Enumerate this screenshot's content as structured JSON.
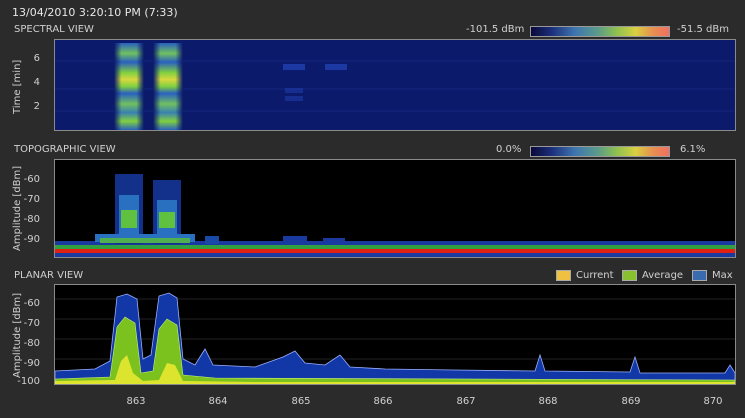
{
  "timestamp": "13/04/2010 3:20:10 PM (7:33)",
  "spectral": {
    "title": "SPECTRAL VIEW",
    "ylabel": "Time [min]",
    "yticks": [
      "6",
      "4",
      "2"
    ],
    "cbar_min": "-101.5 dBm",
    "cbar_max": "-51.5 dBm"
  },
  "topographic": {
    "title": "TOPOGRAPHIC VIEW",
    "ylabel": "Amplitude [dBm]",
    "yticks": [
      "-60",
      "-70",
      "-80",
      "-90"
    ],
    "cbar_min": "0.0%",
    "cbar_max": "6.1%"
  },
  "planar": {
    "title": "PLANAR VIEW",
    "ylabel": "Amplitude [dBm]",
    "yticks": [
      "-60",
      "-70",
      "-80",
      "-90",
      "-100"
    ],
    "legend": [
      {
        "label": "Current",
        "color": "#f0c040"
      },
      {
        "label": "Average",
        "color": "#88c030"
      },
      {
        "label": "Max",
        "color": "#3a6ab0"
      }
    ]
  },
  "xaxis": {
    "ticks": [
      "863",
      "864",
      "865",
      "866",
      "867",
      "868",
      "869",
      "870"
    ]
  },
  "colors": {
    "max_fill": "#1238a8",
    "avg_fill": "#7cc21e",
    "current_fill": "#e8e830",
    "noise_red": "#e02010"
  }
}
